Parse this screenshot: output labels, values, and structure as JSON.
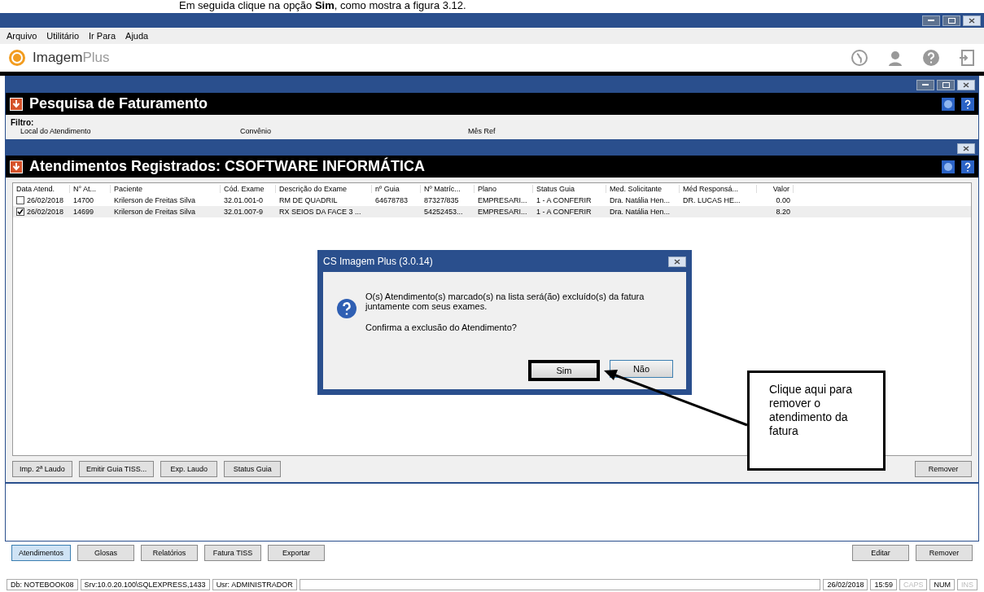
{
  "caption": "Em seguida clique na opção **Sim**, como mostra a figura 3.12.",
  "menu": [
    "Arquivo",
    "Utilitário",
    "Ir Para",
    "Ajuda"
  ],
  "logo": {
    "name": "Imagem",
    "suffix": "Plus"
  },
  "search_window": {
    "heading": "Pesquisa de Faturamento",
    "filter_label": "Filtro:",
    "fields": [
      "Local do Atendimento",
      "Convênio",
      "Mês Ref"
    ]
  },
  "list_window": {
    "heading": "Atendimentos Registrados: CSOFTWARE INFORMÁTICA",
    "columns": [
      "Data Atend.",
      "N° At...",
      "Paciente",
      "Cód. Exame",
      "Descrição do Exame",
      "nº Guia",
      "Nº Matríc...",
      "Plano",
      "Status Guia",
      "Med. Solicitante",
      "Méd Responsá...",
      "Valor"
    ],
    "rows": [
      {
        "checked": false,
        "cells": [
          "26/02/2018",
          "14700",
          "Krilerson de Freitas Silva",
          "32.01.001-0",
          "RM DE QUADRIL",
          "64678783",
          "87327/835",
          "EMPRESARI...",
          "1 - A CONFERIR",
          "Dra. Natália Hen...",
          "DR. LUCAS HE...",
          "0.00"
        ]
      },
      {
        "checked": true,
        "cells": [
          "26/02/2018",
          "14699",
          "Krilerson de Freitas Silva",
          "32.01.007-9",
          "RX SEIOS DA FACE 3 ...",
          "",
          "54252453...",
          "EMPRESARI...",
          "1 - A CONFERIR",
          "Dra. Natália Hen...",
          "",
          "8.20"
        ]
      }
    ],
    "buttons": [
      "Imp. 2ª Laudo",
      "Emitir Guia TISS...",
      "Exp. Laudo",
      "Status Guia"
    ],
    "right_button": "Remover"
  },
  "dialog": {
    "title": "CS Imagem Plus (3.0.14)",
    "message": "O(s) Atendimento(s) marcado(s) na lista será(ão) excluído(s) da fatura juntamente com seus exames.",
    "question": "Confirma a exclusão do Atendimento?",
    "buttons": [
      {
        "label": "Sim",
        "highlighted": true
      },
      {
        "label": "Não",
        "highlighted": false
      }
    ]
  },
  "callout": "Clique aqui para remover o atendimento da fatura",
  "bottom_tabs": [
    {
      "label": "Atendimentos",
      "selected": true
    },
    {
      "label": "Glosas",
      "selected": false
    },
    {
      "label": "Relatórios",
      "selected": false
    },
    {
      "label": "Fatura TISS",
      "selected": false
    },
    {
      "label": "Exportar",
      "selected": false
    }
  ],
  "bottom_buttons": [
    "Editar",
    "Remover"
  ],
  "status_left": [
    "Db: NOTEBOOK08",
    "Srv:10.0.20.100\\SQLEXPRESS,1433",
    "Usr: ADMINISTRADOR"
  ],
  "status_right": [
    {
      "label": "26/02/2018",
      "enabled": true
    },
    {
      "label": "15:59",
      "enabled": true
    },
    {
      "label": "CAPS",
      "enabled": false
    },
    {
      "label": "NUM",
      "enabled": true
    },
    {
      "label": "INS",
      "enabled": false
    }
  ]
}
